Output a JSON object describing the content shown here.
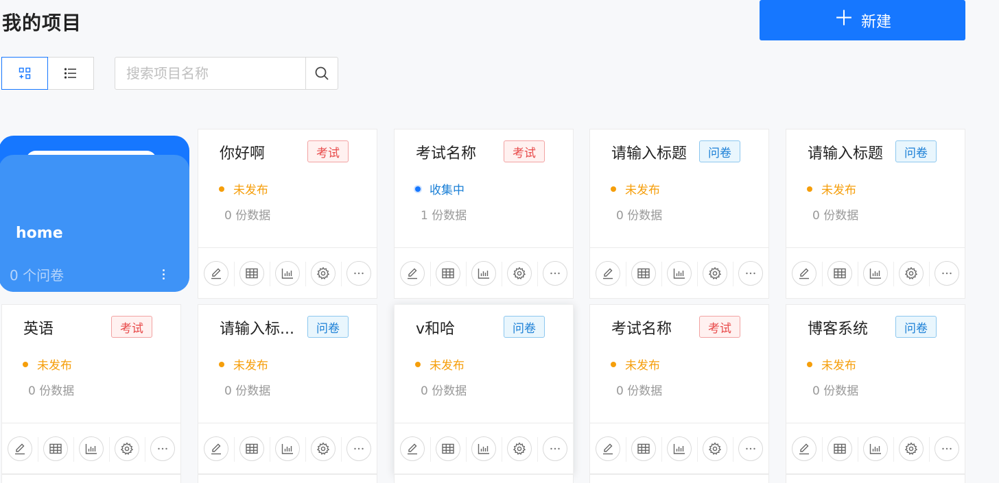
{
  "header": {
    "title": "我的项目",
    "new_button_label": "新建",
    "new_button_icon": "plus-icon"
  },
  "toolbar": {
    "view_modes": [
      {
        "name": "grid-view",
        "icon": "grid-icon",
        "active": true
      },
      {
        "name": "list-view",
        "icon": "list-icon",
        "active": false
      }
    ],
    "search": {
      "placeholder": "搜索项目名称",
      "value": "",
      "button_icon": "search-icon"
    }
  },
  "folder": {
    "name": "home",
    "count_label": "0 个问卷"
  },
  "colors": {
    "primary": "#1677ff",
    "folder_front": "#3e93f7",
    "exam_tag": "#e84a4a",
    "survey_tag": "#1a7fd6",
    "unpublished": "#f59e0b"
  },
  "projects": [
    {
      "title": "你好啊",
      "tag": "考试",
      "tag_type": "exam",
      "status": "未发布",
      "status_type": "unpublished",
      "count": "0 份数据"
    },
    {
      "title": "考试名称",
      "tag": "考试",
      "tag_type": "exam",
      "status": "收集中",
      "status_type": "collecting",
      "count": "1 份数据"
    },
    {
      "title": "请输入标题",
      "tag": "问卷",
      "tag_type": "survey",
      "status": "未发布",
      "status_type": "unpublished",
      "count": "0 份数据"
    },
    {
      "title": "请输入标题",
      "tag": "问卷",
      "tag_type": "survey",
      "status": "未发布",
      "status_type": "unpublished",
      "count": "0 份数据"
    },
    {
      "title": "英语",
      "tag": "考试",
      "tag_type": "exam",
      "status": "未发布",
      "status_type": "unpublished",
      "count": "0 份数据"
    },
    {
      "title": "请输入标...",
      "tag": "问卷",
      "tag_type": "survey",
      "status": "未发布",
      "status_type": "unpublished",
      "count": "0 份数据"
    },
    {
      "title": "v和哈",
      "tag": "问卷",
      "tag_type": "survey",
      "status": "未发布",
      "status_type": "unpublished",
      "count": "0 份数据"
    },
    {
      "title": "考试名称",
      "tag": "考试",
      "tag_type": "exam",
      "status": "未发布",
      "status_type": "unpublished",
      "count": "0 份数据"
    },
    {
      "title": "博客系统",
      "tag": "问卷",
      "tag_type": "survey",
      "status": "未发布",
      "status_type": "unpublished",
      "count": "0 份数据"
    }
  ],
  "card_actions": [
    {
      "name": "edit",
      "icon": "edit-icon"
    },
    {
      "name": "data",
      "icon": "table-icon"
    },
    {
      "name": "stats",
      "icon": "chart-icon"
    },
    {
      "name": "settings",
      "icon": "gear-icon"
    },
    {
      "name": "more",
      "icon": "more-icon"
    }
  ]
}
